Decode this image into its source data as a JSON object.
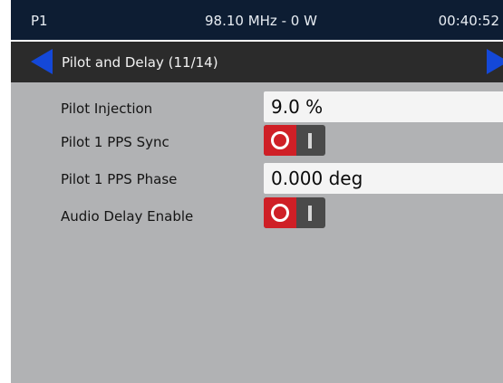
{
  "status_bar": {
    "program": "P1",
    "frequency_power": "98.10 MHz - 0 W",
    "time": "00:40:52"
  },
  "nav": {
    "title": "Pilot and Delay (11/14)",
    "prev_icon": "left-arrow-icon",
    "next_icon": "right-arrow-icon"
  },
  "settings": [
    {
      "label": "Pilot Injection",
      "type": "value",
      "value": "9.0 %"
    },
    {
      "label": "Pilot 1 PPS Sync",
      "type": "toggle",
      "state": "off"
    },
    {
      "label": "Pilot 1 PPS Phase",
      "type": "value",
      "value": "0.000 deg"
    },
    {
      "label": "Audio Delay Enable",
      "type": "toggle",
      "state": "off"
    }
  ],
  "colors": {
    "status_bar_bg": "#0d1d33",
    "nav_bar_bg": "#2b2b2b",
    "content_bg": "#b1b2b4",
    "arrow": "#1448d8",
    "toggle_off": "#cf1f26"
  }
}
